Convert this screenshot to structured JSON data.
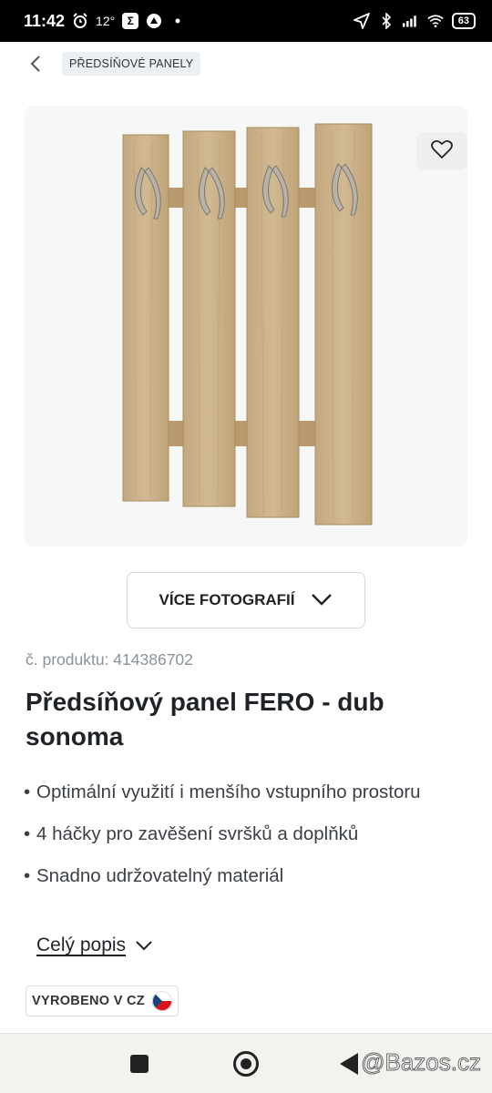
{
  "status_bar": {
    "time": "11:42",
    "temperature": "12°",
    "battery": "63"
  },
  "breadcrumb": {
    "category": "PŘEDSÍŇOVÉ PANELY"
  },
  "gallery": {
    "more_photos_label": "VÍCE FOTOGRAFIÍ",
    "main_image_icon": "coat-rack-panel"
  },
  "product": {
    "code": "č. produktu: 414386702",
    "title": "Předsíňový panel FERO - dub sonoma",
    "features": [
      "Optimální využití i menšího vstupního prostoru",
      "4 háčky pro zavěšení svršků a doplňků",
      "Snadno udržovatelný materiál"
    ],
    "full_description_label": "Celý popis",
    "made_in_badge": "VYROBENO V CZ"
  },
  "watermark": "@Bazos.cz",
  "colors": {
    "wood": "#c9b08a",
    "chip_bg": "#eceff1",
    "code_text": "#8a929c",
    "nav_bg": "#f1f3ee"
  }
}
